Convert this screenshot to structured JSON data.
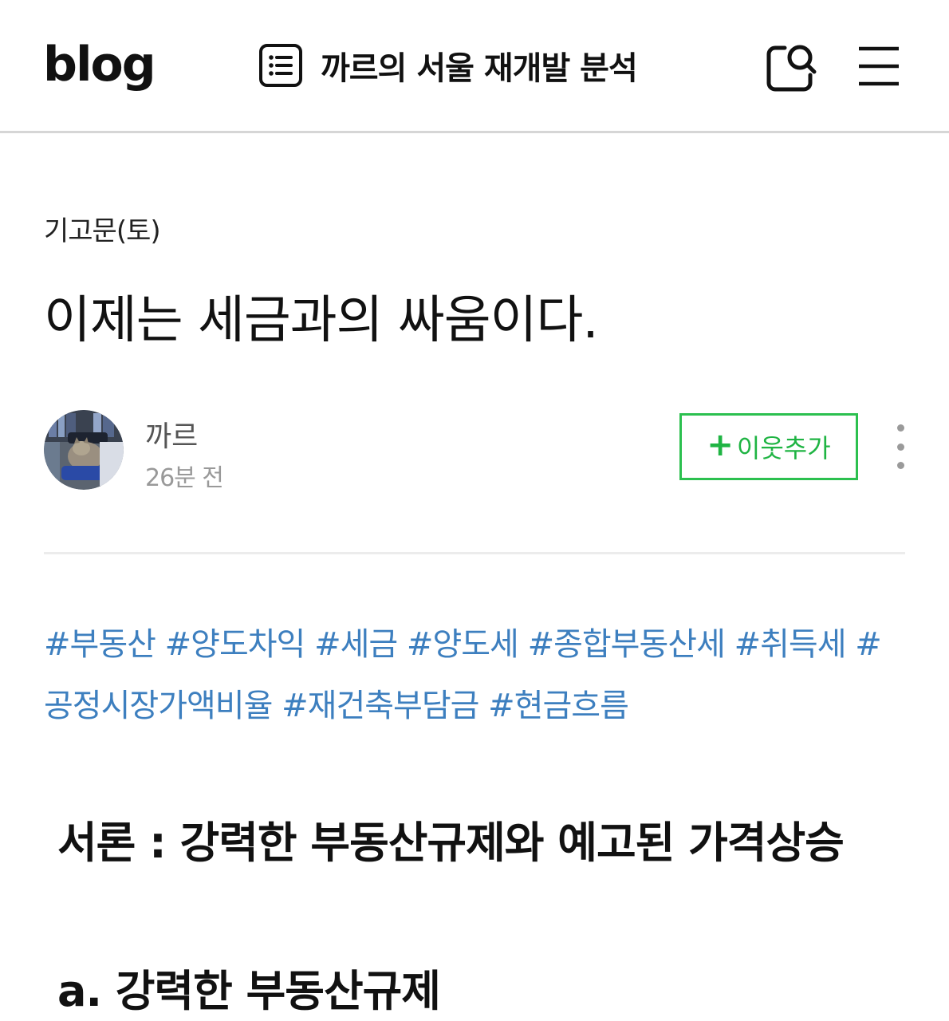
{
  "header": {
    "logo": "blog",
    "blog_title": "까르의 서울 재개발 분석",
    "icons": {
      "list": "list-icon",
      "search": "search-icon",
      "menu": "hamburger-menu-icon"
    }
  },
  "post": {
    "category": "기고문(토)",
    "title": "이제는 세금과의 싸움이다.",
    "author": {
      "name": "까르",
      "time": "26분 전",
      "avatar": "avatar-cat-photo"
    },
    "follow_button": {
      "plus": "+",
      "label": "이웃추가"
    },
    "more_icon": "more-vertical-icon",
    "tags_line1": [
      "#부동산",
      "#양도차익",
      "#세금",
      "#양도세",
      "#종합부동산세",
      "#취득세",
      "#"
    ],
    "tags_line2": [
      "공정시장가액비율",
      "#재건축부담금",
      "#현금흐름"
    ],
    "section_heading": "서론 : 강력한 부동산규제와 예고된 가격상승",
    "sub_heading": "a. 강력한 부동산규제"
  },
  "colors": {
    "tag": "#3d7fbf",
    "follow_green": "#1fb443",
    "divider": "#ececec"
  }
}
